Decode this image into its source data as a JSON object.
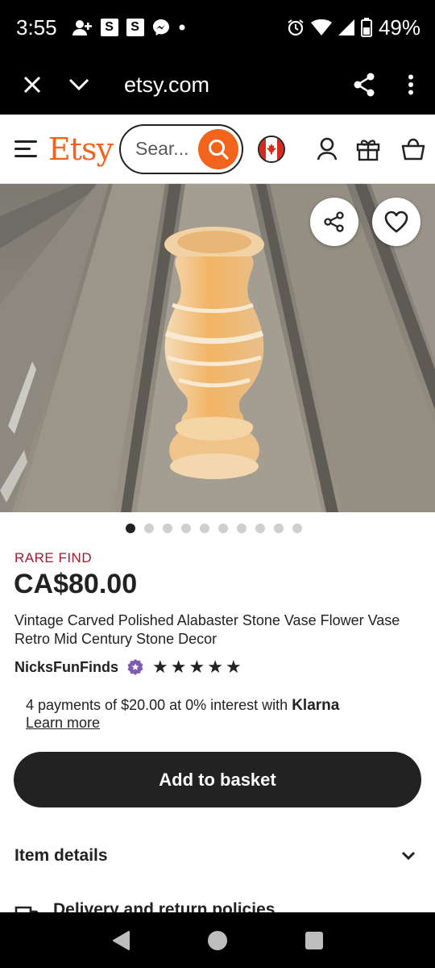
{
  "status_bar": {
    "time": "3:55",
    "battery": "49%",
    "icons": [
      "person-add-icon",
      "s-app-icon",
      "s-app-icon",
      "messenger-icon",
      "dot-icon",
      "alarm-icon",
      "wifi-icon",
      "signal-icon",
      "battery-icon"
    ],
    "s_label": "S"
  },
  "browser": {
    "url": "etsy.com"
  },
  "header": {
    "logo": "Etsy",
    "search_placeholder": "Sear...",
    "brand_color": "#F1641E"
  },
  "product": {
    "badge": "RARE FIND",
    "price": "CA$80.00",
    "title": "Vintage Carved Polished Alabaster Stone Vase Flower Vase Retro Mid Century Stone Decor",
    "shop_name": "NicksFunFinds",
    "rating_stars": 5,
    "image_count": 10,
    "active_image_index": 0
  },
  "klarna": {
    "text": "4 payments of $20.00 at 0% interest with",
    "brand": "Klarna",
    "learn_more": "Learn more"
  },
  "actions": {
    "add_to_basket": "Add to basket"
  },
  "accordions": {
    "item_details": "Item details",
    "delivery": "Delivery and return policies"
  }
}
